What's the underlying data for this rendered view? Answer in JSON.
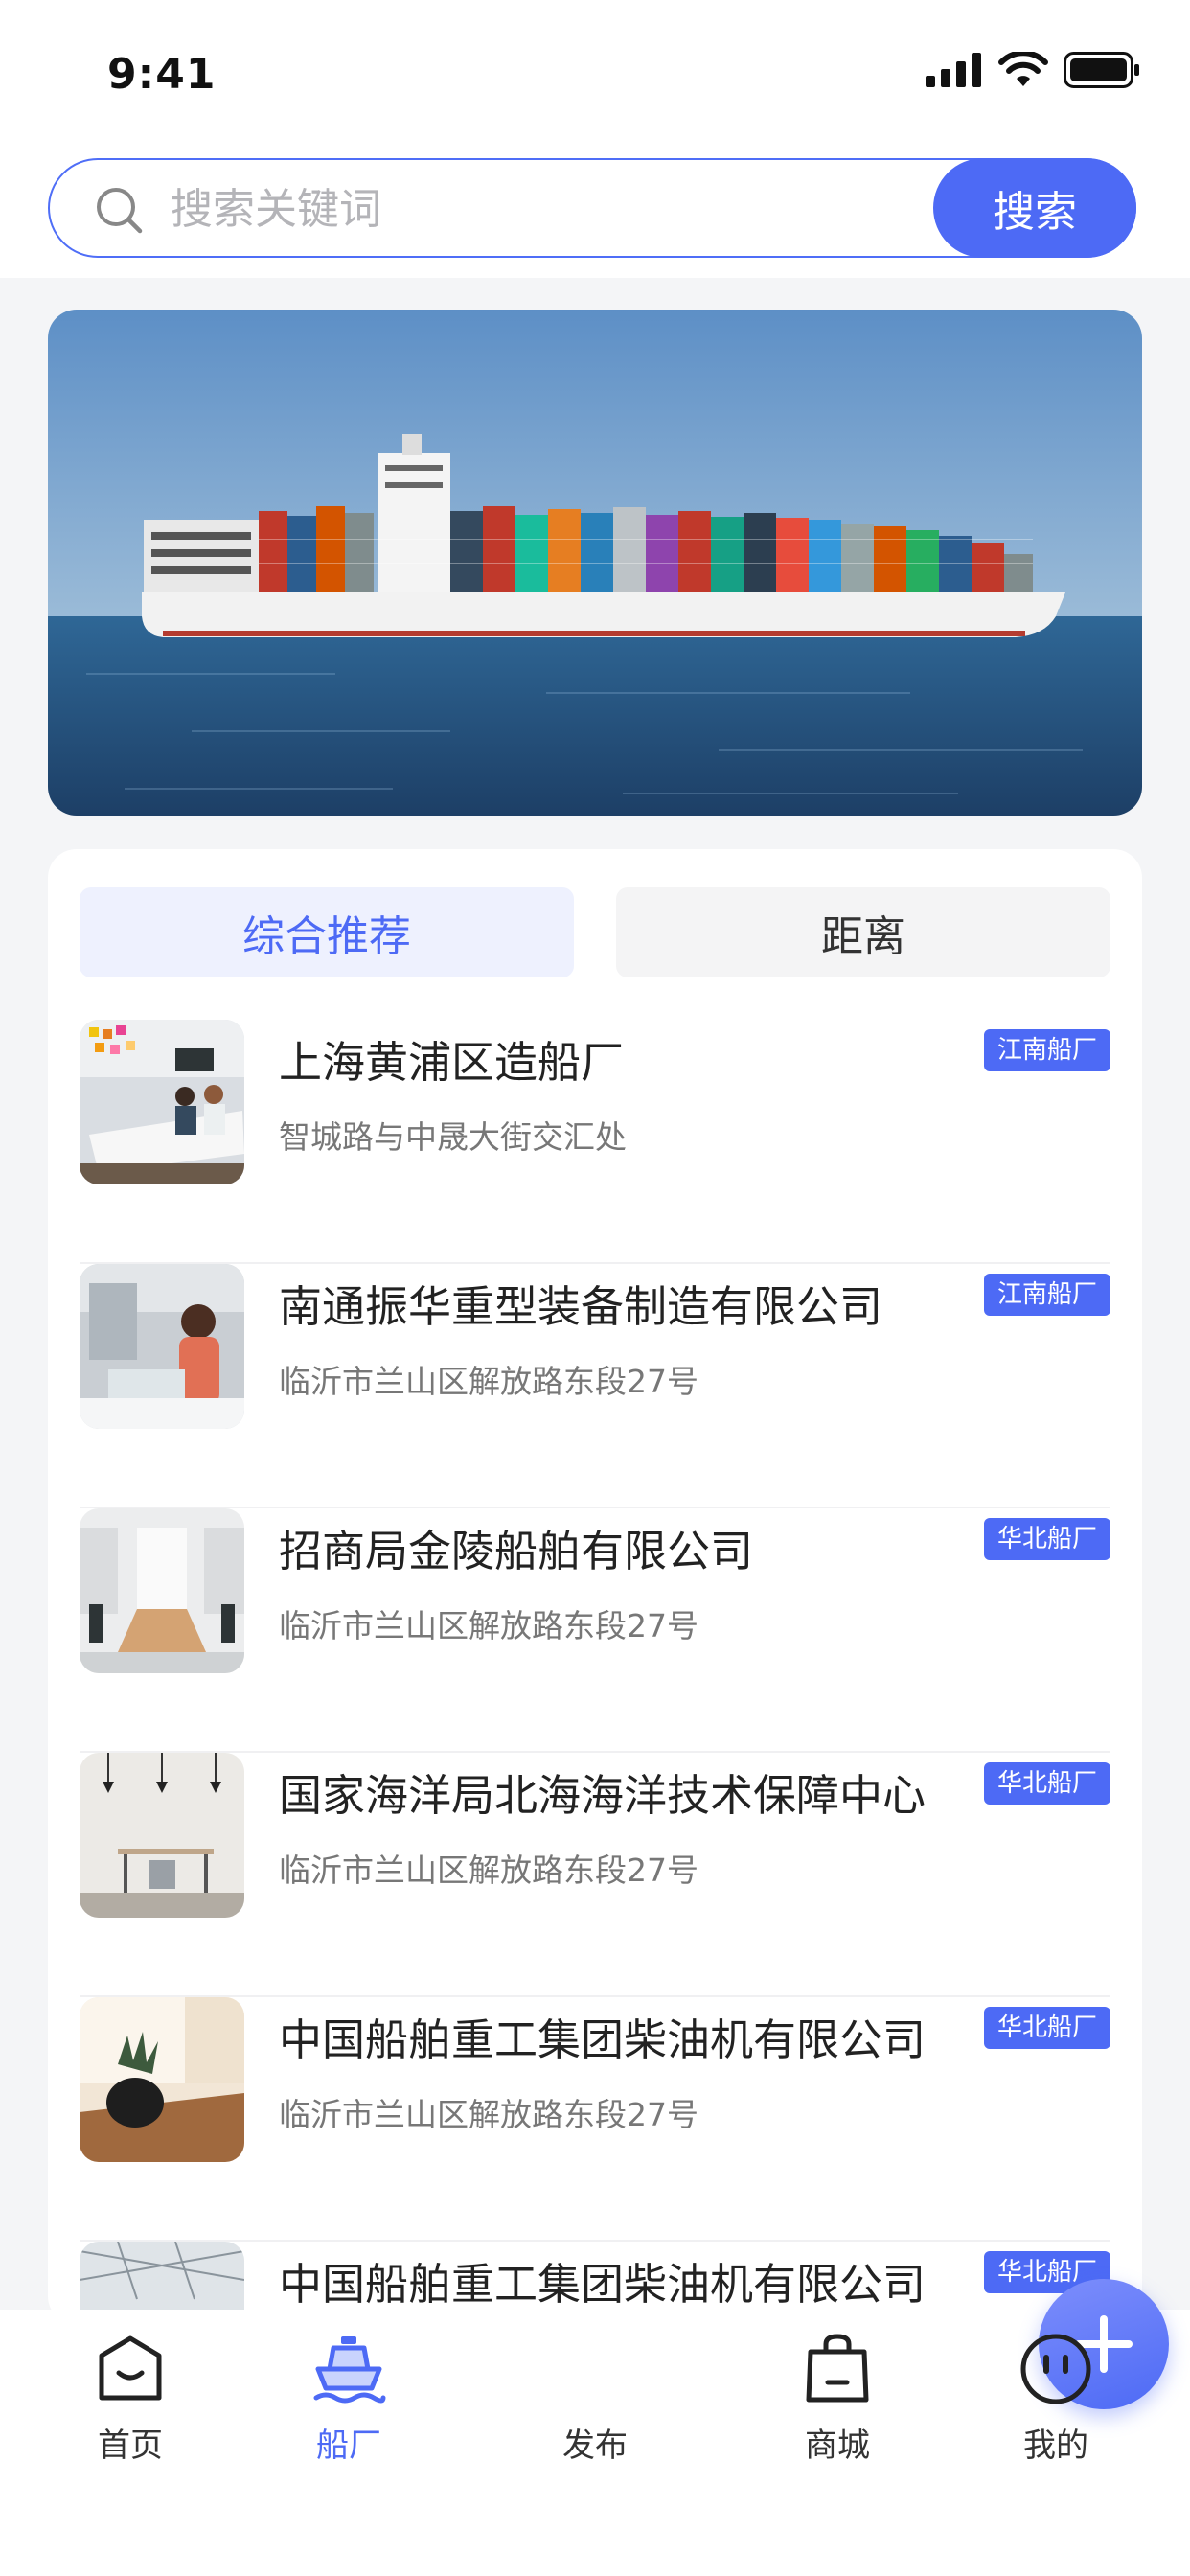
{
  "status_bar": {
    "time": "9:41"
  },
  "search": {
    "placeholder": "搜索关键词",
    "button_label": "搜索"
  },
  "tabs": [
    {
      "label": "综合推荐",
      "active": true
    },
    {
      "label": "距离",
      "active": false
    }
  ],
  "shipyards": [
    {
      "name": "上海黄浦区造船厂",
      "address": "智城路与中晟大街交汇处",
      "tag": "江南船厂"
    },
    {
      "name": "南通振华重型装备制造有限公司",
      "address": "临沂市兰山区解放路东段27号",
      "tag": "江南船厂"
    },
    {
      "name": "招商局金陵船舶有限公司",
      "address": "临沂市兰山区解放路东段27号",
      "tag": "华北船厂"
    },
    {
      "name": "国家海洋局北海海洋技术保障中心",
      "address": "临沂市兰山区解放路东段27号",
      "tag": "华北船厂"
    },
    {
      "name": "中国船舶重工集团柴油机有限公司",
      "address": "临沂市兰山区解放路东段27号",
      "tag": "华北船厂"
    },
    {
      "name": "中国船舶重工集团柴油机有限公司",
      "address": "",
      "tag": "华北船厂"
    }
  ],
  "bottom_nav": [
    {
      "label": "首页",
      "icon": "home-icon",
      "active": false
    },
    {
      "label": "船厂",
      "icon": "ship-icon",
      "active": true
    },
    {
      "label": "发布",
      "icon": "plus-icon",
      "active": false
    },
    {
      "label": "商城",
      "icon": "shopping-bag-icon",
      "active": false
    },
    {
      "label": "我的",
      "icon": "profile-icon",
      "active": false
    }
  ],
  "colors": {
    "accent": "#4d6af5",
    "tab_active_bg": "#eef1fe"
  }
}
